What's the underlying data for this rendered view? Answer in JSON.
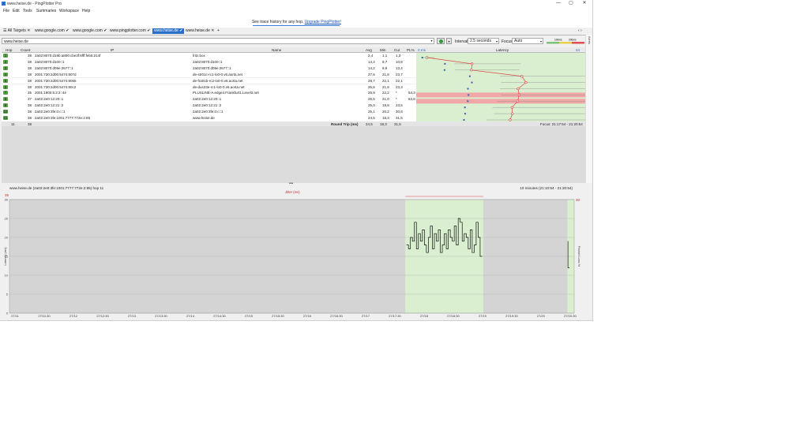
{
  "window": {
    "title": "www.heise.de - PingPlotter Pro",
    "minimize": "—",
    "maximize": "▢",
    "close": "✕"
  },
  "menu": [
    "File",
    "Edit",
    "Tools",
    "Summaries",
    "Workspace",
    "Help"
  ],
  "banner": {
    "text": "See trace history for any hop.",
    "link": "Upgrade PingPlotter!"
  },
  "tabs": [
    {
      "label": "All Targets",
      "active": false
    },
    {
      "label": "www.google.com",
      "active": false
    },
    {
      "label": "www.google.com",
      "active": false
    },
    {
      "label": "www.pingplotter.com",
      "active": false
    },
    {
      "label": "www.heise.de",
      "active": true
    },
    {
      "label": "www.heise.de",
      "active": false
    }
  ],
  "toolbar": {
    "target": "www.heise.de",
    "interval_label": "Interval",
    "interval_value": "2.5 seconds",
    "focus_label": "Focus",
    "focus_value": "Auto",
    "legend_left": "100ms",
    "legend_right": "200ms",
    "alerts_label": "Alerts"
  },
  "grid": {
    "columns": [
      "Hop",
      "Count",
      "IP",
      "Name",
      "Avg",
      "Min",
      "Cur",
      "PL%",
      "Latency"
    ],
    "latency_start": "0 ms",
    "latency_end": "44 ms",
    "rows": [
      {
        "hop": "1",
        "count": "38",
        "ip": "2a02:8070:d19b:a800:cbe3f:6fff:feb5:214f",
        "name": "fritz.box",
        "avg": "2,4",
        "min": "1,1",
        "cur": "1,3",
        "pl": "",
        "lat": 2.4
      },
      {
        "hop": "2",
        "count": "38",
        "ip": "2a02:8070:d100::1",
        "name": "2a02:8070:d100::1",
        "avg": "14,4",
        "min": "9,7",
        "cur": "10,8",
        "pl": "",
        "lat": 14.4
      },
      {
        "hop": "3",
        "count": "38",
        "ip": "2a02:8070:d09e:2677::1",
        "name": "2a02:8070:d09e:2677::1",
        "avg": "14,2",
        "min": "9,9",
        "cur": "13,4",
        "pl": "",
        "lat": 14.2
      },
      {
        "hop": "4",
        "count": "38",
        "ip": "2001:730:2d00:5474:807d",
        "name": "de-str01c-rc1-lo0-0.v6.aorta.net",
        "avg": "27,6",
        "min": "21,8",
        "cur": "23,7",
        "pl": "",
        "lat": 27.6
      },
      {
        "hop": "5",
        "count": "38",
        "ip": "2001:730:2d00:5474:8065",
        "name": "de-fra01b-rc2-lo0-0.v6.aorta.net",
        "avg": "28,7",
        "min": "22,1",
        "cur": "22,1",
        "pl": "",
        "lat": 28.7
      },
      {
        "hop": "6",
        "count": "38",
        "ip": "2001:730:2d00:5474:80c2",
        "name": "de-dus23e-rc1-lo0-0.v6.aorta.net",
        "avg": "26,6",
        "min": "21,8",
        "cur": "23,3",
        "pl": "",
        "lat": 26.6
      },
      {
        "hop": "7",
        "count": "35",
        "ip": "2001:1900:5:2:2::4e",
        "name": "PLUSLINE-A.edge4.Frankfurt1.Level3.net",
        "avg": "26,9",
        "min": "22,2",
        "cur": "*",
        "pl": "54,3",
        "lat": 26.9,
        "loss": true
      },
      {
        "hop": "8",
        "count": "37",
        "ip": "2a02:2e0:12:20::1",
        "name": "2a02:2e0:12:20::1",
        "avg": "26,5",
        "min": "21,0",
        "cur": "*",
        "pl": "63,8",
        "lat": 26.5,
        "loss": true
      },
      {
        "hop": "9",
        "count": "38",
        "ip": "2a02:2e0:12:21::2",
        "name": "2a02:2e0:12:21::2",
        "avg": "25,0",
        "min": "19,8",
        "cur": "23,5",
        "pl": "",
        "lat": 25.0
      },
      {
        "hop": "10",
        "count": "38",
        "ip": "2a02:2e0:3fe:0:c::1",
        "name": "2a02:2e0:3fe:0:c::1",
        "avg": "25,1",
        "min": "20,2",
        "cur": "30,8",
        "pl": "",
        "lat": 25.1
      },
      {
        "hop": "11",
        "count": "38",
        "ip": "2a02:2e0:3fe:1001:7777:772e:2:85",
        "name": "www.heise.de",
        "avg": "24,5",
        "min": "18,3",
        "cur": "31,5",
        "pl": "",
        "lat": 24.5
      }
    ],
    "summary": {
      "hops": "11",
      "count": "38",
      "label": "Round Trip (ms)",
      "avg": "24,5",
      "min": "18,3",
      "cur": "31,5",
      "focus": "Focus: 21:17:54 - 21:20:54"
    }
  },
  "timeline": {
    "title": "www.heise.de (2a02:2e0:3fe:1001:7777:772e:2:85) hop 11",
    "range": "10 minutes (21:10:54 - 21:20:54)",
    "jitter_label": "Jitter (ms)",
    "left_axis_top": "35",
    "y_max": "30",
    "y_axis_label": "Latency (ms)",
    "right_axis_label": "Packet Loss %",
    "right_axis_top": "30",
    "x_ticks": [
      "27/11",
      "27/11:30",
      "27/12",
      "27/12:30",
      "27/13",
      "27/13:30",
      "27/14",
      "27/14:30",
      "27/15",
      "27/15:30",
      "27/16",
      "27/16:30",
      "27/17",
      "27/17:30",
      "27/18",
      "27/18:30",
      "27/19",
      "27/19:30",
      "27/20",
      "27/20:30"
    ],
    "y_ticks": [
      "30",
      "25",
      "20",
      "15",
      "10",
      "5",
      "0"
    ],
    "samples": [
      18,
      17,
      20,
      19,
      24,
      17,
      21,
      19,
      22,
      18,
      16,
      20,
      23,
      17,
      21,
      19,
      22,
      16,
      18,
      21,
      17,
      22,
      20,
      19,
      23,
      18,
      25,
      24,
      19,
      21,
      20,
      17,
      22,
      16,
      18,
      24,
      20,
      15
    ]
  }
}
